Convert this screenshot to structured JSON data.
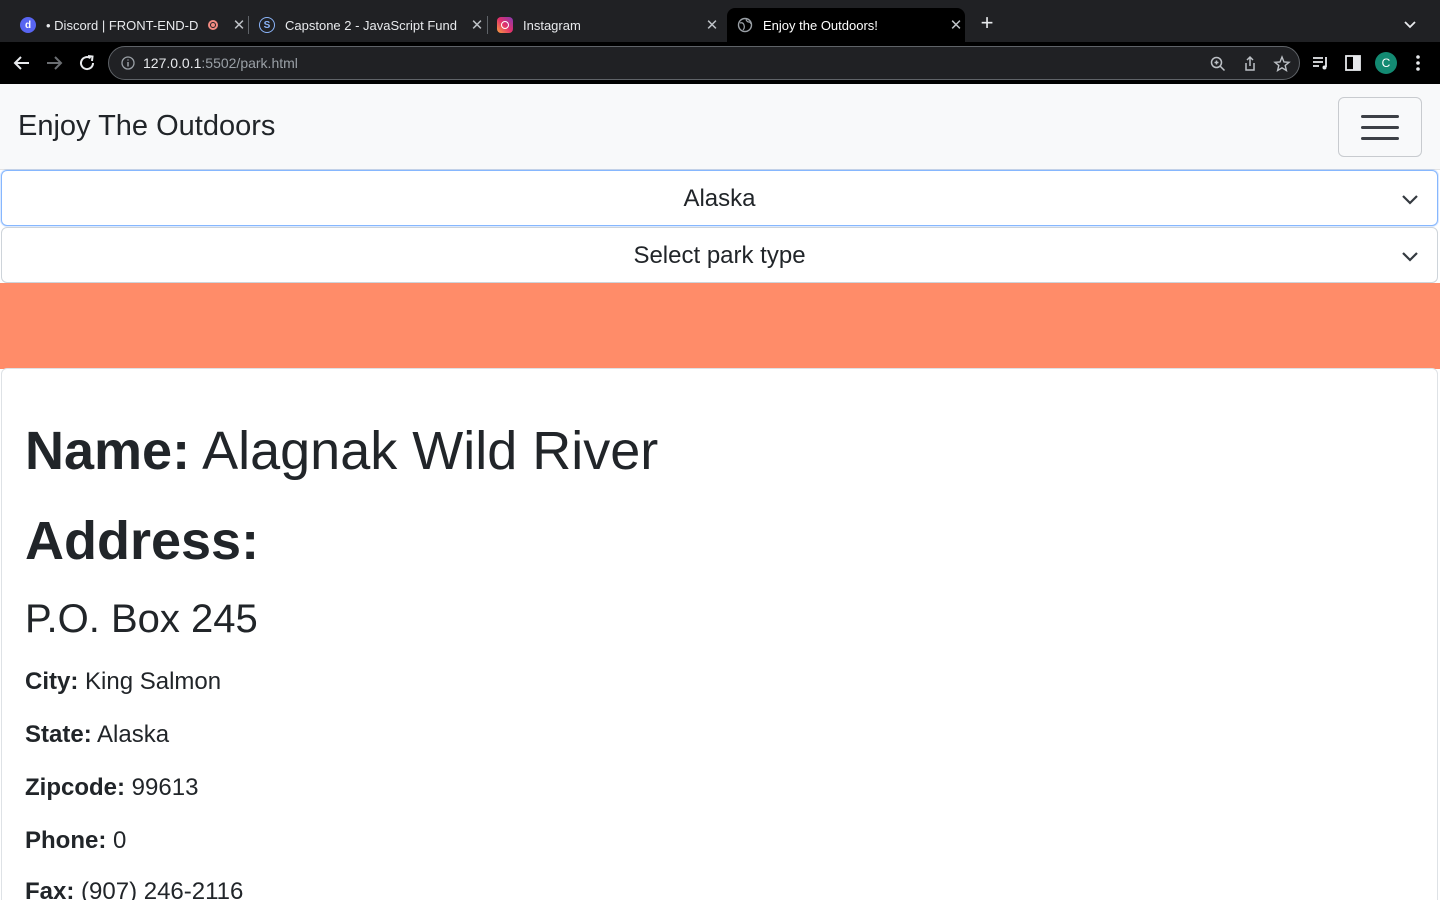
{
  "browser": {
    "tabs": [
      {
        "title": "• Discord | FRONT-END-D",
        "icon": "discord-icon",
        "active": false
      },
      {
        "title": "Capstone 2 - JavaScript Fund",
        "icon": "capstone-icon",
        "active": false
      },
      {
        "title": "Instagram",
        "icon": "instagram-icon",
        "active": false
      },
      {
        "title": "Enjoy the Outdoors!",
        "icon": "globe-icon",
        "active": true
      }
    ],
    "url_host": "127.0.0.1",
    "url_path": ":5502/park.html",
    "profile_initial": "C",
    "profile_color": "#138a72"
  },
  "page": {
    "brand": "Enjoy The Outdoors",
    "state_select": {
      "value": "Alaska"
    },
    "type_select": {
      "value": "Select park type"
    },
    "band_color": "#ff8c69",
    "park": {
      "name_label": "Name:",
      "name": "Alagnak Wild River",
      "address_label": "Address:",
      "address_line": "P.O. Box 245",
      "city_label": "City:",
      "city": "King Salmon",
      "state_label": "State:",
      "state": "Alaska",
      "zip_label": "Zipcode:",
      "zip": "99613",
      "phone_label": "Phone:",
      "phone": "0",
      "fax_label": "Fax:",
      "fax": "(907) 246-2116"
    }
  }
}
